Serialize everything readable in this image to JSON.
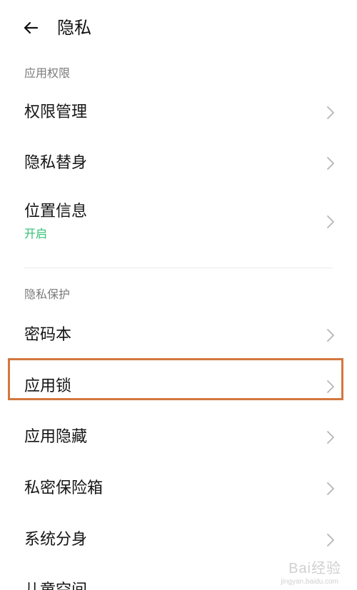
{
  "header": {
    "title": "隐私"
  },
  "sections": {
    "app_permissions": {
      "title": "应用权限",
      "items": [
        {
          "label": "权限管理"
        },
        {
          "label": "隐私替身"
        },
        {
          "label": "位置信息",
          "status": "开启"
        }
      ]
    },
    "privacy_protection": {
      "title": "隐私保护",
      "items": [
        {
          "label": "密码本"
        },
        {
          "label": "应用锁"
        },
        {
          "label": "应用隐藏"
        },
        {
          "label": "私密保险箱"
        },
        {
          "label": "系统分身"
        },
        {
          "label": "儿童空间"
        }
      ]
    }
  },
  "colors": {
    "status_green": "#2fbf71",
    "highlight_border": "#d3773f"
  },
  "icons": {
    "back": "arrow-left-icon",
    "chevron": "chevron-right-icon"
  },
  "watermark": {
    "text": "Bai经验",
    "sub": "jingyan.baidu.com"
  }
}
